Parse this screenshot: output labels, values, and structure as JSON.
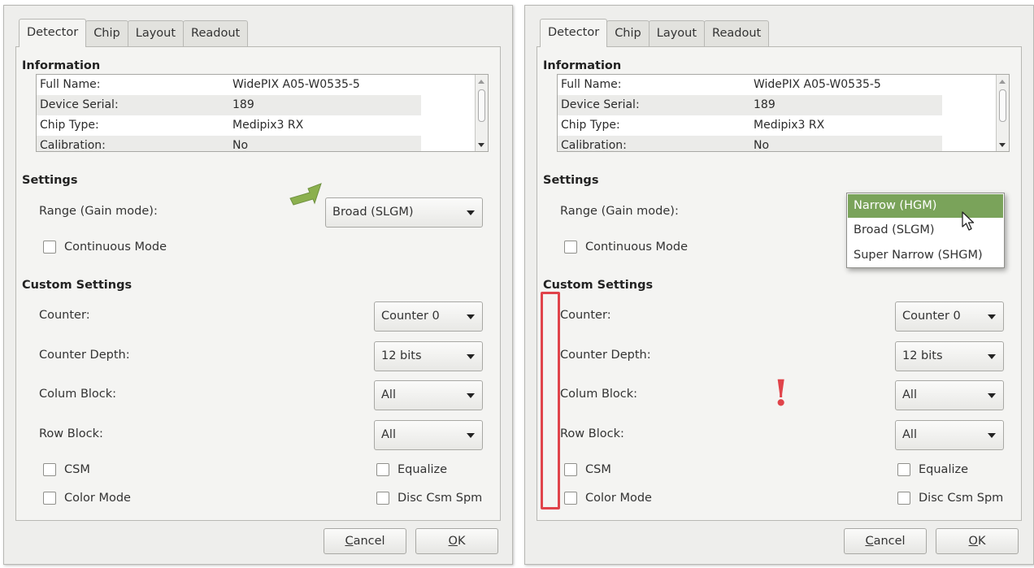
{
  "colors": {
    "selection": "#7aa35a",
    "arrow": "#8bb04e",
    "annotation": "#e0434a"
  },
  "left": {
    "tabs": [
      "Detector",
      "Chip",
      "Layout",
      "Readout"
    ],
    "information_title": "Information",
    "info_rows": [
      {
        "key": "Full Name:",
        "value": "WidePIX A05-W0535-5"
      },
      {
        "key": "Device Serial:",
        "value": "189"
      },
      {
        "key": "Chip Type:",
        "value": "Medipix3 RX"
      },
      {
        "key": "Calibration:",
        "value": "No"
      }
    ],
    "settings_title": "Settings",
    "range_label": "Range (Gain mode):",
    "range_value": "Broad (SLGM)",
    "continuous_mode": "Continuous Mode",
    "custom_title": "Custom Settings",
    "counter_label": "Counter:",
    "counter_value": "Counter 0",
    "depth_label": "Counter Depth:",
    "depth_value": "12 bits",
    "colum_label": "Colum Block:",
    "colum_value": "All",
    "row_label": "Row Block:",
    "row_value": "All",
    "csm": "CSM",
    "equalize": "Equalize",
    "color_mode": "Color Mode",
    "disc": "Disc Csm Spm",
    "cancel_underlined": "C",
    "cancel_rest": "ancel",
    "ok_underlined": "O",
    "ok_rest": "K",
    "hint_arrow_icon": "green-arrow-icon"
  },
  "right": {
    "tabs": [
      "Detector",
      "Chip",
      "Layout",
      "Readout"
    ],
    "information_title": "Information",
    "info_rows": [
      {
        "key": "Full Name:",
        "value": "WidePIX A05-W0535-5"
      },
      {
        "key": "Device Serial:",
        "value": "189"
      },
      {
        "key": "Chip Type:",
        "value": "Medipix3 RX"
      },
      {
        "key": "Calibration:",
        "value": "No"
      }
    ],
    "settings_title": "Settings",
    "range_label": "Range (Gain mode):",
    "range_options": [
      "Narrow (HGM)",
      "Broad (SLGM)",
      "Super Narrow (SHGM)"
    ],
    "range_highlighted": "Narrow (HGM)",
    "continuous_mode": "Continuous Mode",
    "custom_title": "Custom Settings",
    "counter_label": "Counter:",
    "counter_value": "Counter 0",
    "depth_label": "Counter Depth:",
    "depth_value": "12 bits",
    "colum_label": "Colum Block:",
    "colum_value": "All",
    "row_label": "Row Block:",
    "row_value": "All",
    "csm": "CSM",
    "equalize": "Equalize",
    "color_mode": "Color Mode",
    "disc": "Disc Csm Spm",
    "cancel_underlined": "C",
    "cancel_rest": "ancel",
    "ok_underlined": "O",
    "ok_rest": "K",
    "annotation_mark": "!",
    "cursor_icon": "mouse-pointer-icon"
  }
}
